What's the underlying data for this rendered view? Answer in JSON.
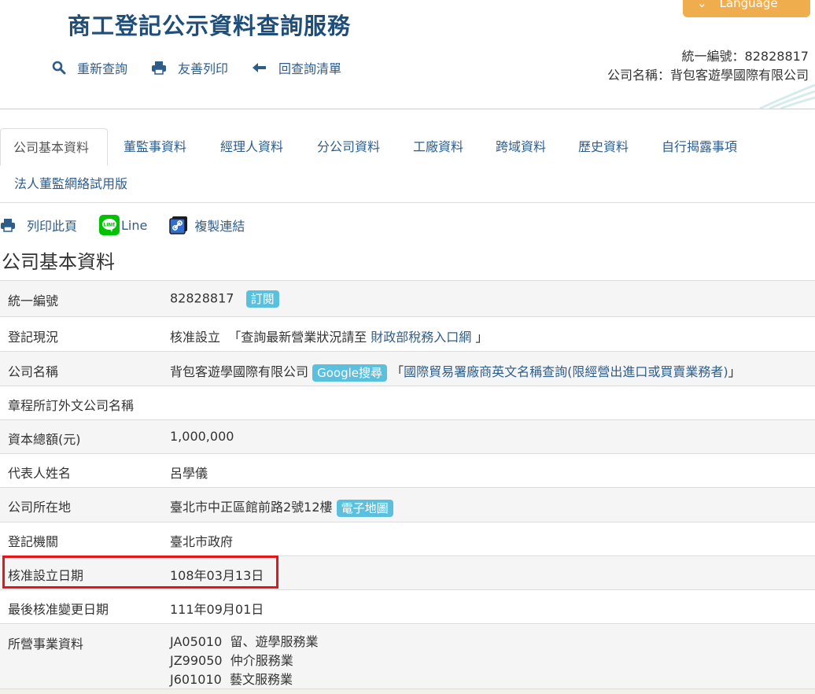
{
  "header": {
    "title": "商工登記公示資料查詢服務",
    "language_label": "Language",
    "actions": [
      {
        "label": "重新查詢",
        "icon": "search-icon"
      },
      {
        "label": "友善列印",
        "icon": "print-icon"
      },
      {
        "label": "回查詢清單",
        "icon": "arrow-left-icon"
      }
    ],
    "info_id": "統一編號：82828817",
    "info_name": "公司名稱：背包客遊學國際有限公司"
  },
  "tabs": [
    "公司基本資料",
    "董監事資料",
    "經理人資料",
    "分公司資料",
    "工廠資料",
    "跨域資料",
    "歷史資料",
    "自行揭露事項",
    "法人董監網絡試用版"
  ],
  "share_bar": {
    "print": "列印此頁",
    "line": "Line",
    "copy_link": "複製連結"
  },
  "section_title": "公司基本資料",
  "rows": {
    "unified_number": {
      "label": "統一編號",
      "value": "82828817",
      "badge": "訂閱"
    },
    "status": {
      "label": "登記現況",
      "value": "核准設立",
      "note_pre": "「查詢最新營業狀況請至",
      "note_link": "財政部稅務入口網",
      "note_post": "」"
    },
    "company_name": {
      "label": "公司名稱",
      "value": "背包客遊學國際有限公司",
      "badge": "Google搜尋",
      "note_pre": "「",
      "note_link": "國際貿易署廠商英文名稱查詢(限經營出進口或買賣業務者)",
      "note_post": "」"
    },
    "foreign_name": {
      "label": "章程所訂外文公司名稱",
      "value": ""
    },
    "capital": {
      "label": "資本總額(元)",
      "value": "1,000,000"
    },
    "representative": {
      "label": "代表人姓名",
      "value": "呂學儀"
    },
    "address": {
      "label": "公司所在地",
      "value": "臺北市中正區館前路2號12樓",
      "badge": "電子地圖"
    },
    "authority": {
      "label": "登記機關",
      "value": "臺北市政府"
    },
    "approval_date": {
      "label": "核准設立日期",
      "value": "108年03月13日"
    },
    "last_change_date": {
      "label": "最後核准變更日期",
      "value": "111年09月01日"
    },
    "business": {
      "label": "所營事業資料",
      "items": [
        "JA05010  留、遊學服務業",
        "JZ99050  仲介服務業",
        "J601010  藝文服務業"
      ]
    }
  },
  "colors": {
    "title": "#1f4e79",
    "link": "#2f5d8a",
    "badge": "#5bc0de",
    "language_button": "#f0ad4e",
    "highlight": "#e8141a"
  }
}
